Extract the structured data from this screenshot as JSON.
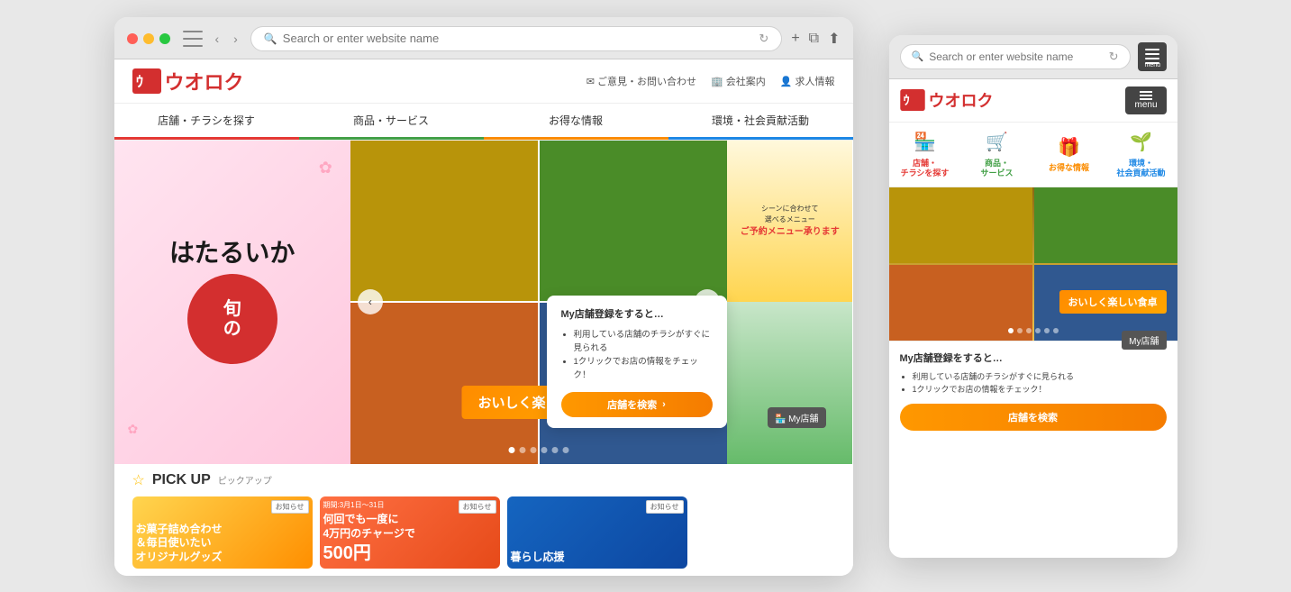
{
  "desktop": {
    "address_bar": {
      "placeholder": "Search or enter website name"
    },
    "site": {
      "logo_text": "ウオロク",
      "header_links": [
        {
          "icon": "✉",
          "label": "ご意見・お問い合わせ"
        },
        {
          "icon": "🏢",
          "label": "会社案内"
        },
        {
          "icon": "👤",
          "label": "求人情報"
        }
      ],
      "nav_items": [
        {
          "label": "店舗・チラシを探す",
          "color": "#e53935"
        },
        {
          "label": "商品・サービス",
          "color": "#43a047"
        },
        {
          "label": "お得な情報",
          "color": "#fb8c00"
        },
        {
          "label": "環境・社会貢献活動",
          "color": "#1e88e5"
        }
      ],
      "hero": {
        "left_text": "はたるいか",
        "circle_text": "旬",
        "overlay_text": "おいしく楽しい食卓",
        "dots": [
          true,
          false,
          false,
          false,
          false,
          false
        ],
        "right_banner_text": "シーンに合わせて選べるメニュー\nご予約メニュー承ります"
      },
      "my_store": {
        "tag_label": "My店舗",
        "title": "My店舗登録をすると…",
        "points": [
          "利用している店舗のチラシがすぐに見られる",
          "1クリックでお店の情報をチェック！"
        ],
        "button_label": "店舗を検索",
        "button_arrow": "›"
      },
      "pickup": {
        "star": "☆",
        "title": "PICK UP",
        "kana": "ピックアップ",
        "cards": [
          {
            "badge": "お知らせ",
            "text": "お菓子詰め合わせ＆毎日使いたいオリジナルグッズ",
            "bg": "card1"
          },
          {
            "badge": "お知らせ",
            "text": "期間:3月1日～31日 何回でも一度に4万円のチャージで 500円",
            "bg": "card2"
          },
          {
            "badge": "お知らせ",
            "text": "暮らし応援",
            "bg": "card3"
          }
        ]
      }
    }
  },
  "mobile": {
    "address_bar": {
      "placeholder": "Search or enter website name"
    },
    "site": {
      "logo_text": "ウオロク",
      "menu_label": "menu",
      "nav_icons": [
        {
          "icon": "🏪",
          "label": "店舗・\nチラシを探す",
          "color": "nav-icon-red"
        },
        {
          "icon": "🛒",
          "label": "商品・\nサービス",
          "color": "nav-icon-green"
        },
        {
          "icon": "🎁",
          "label": "お得な情報",
          "color": "nav-icon-orange"
        },
        {
          "icon": "🌱",
          "label": "環境・\n社会貢献活動",
          "color": "nav-icon-blue"
        }
      ],
      "hero": {
        "overlay_text": "おいしく楽しい食卓",
        "dots": [
          true,
          false,
          false,
          false,
          false,
          false
        ]
      },
      "my_store": {
        "badge": "My店舗",
        "title": "My店舗登録をすると…",
        "points": [
          "利用している店舗のチラシがすぐに見られる",
          "1クリックでお店の情報をチェック！"
        ],
        "button_label": "店舗を検索"
      }
    }
  }
}
